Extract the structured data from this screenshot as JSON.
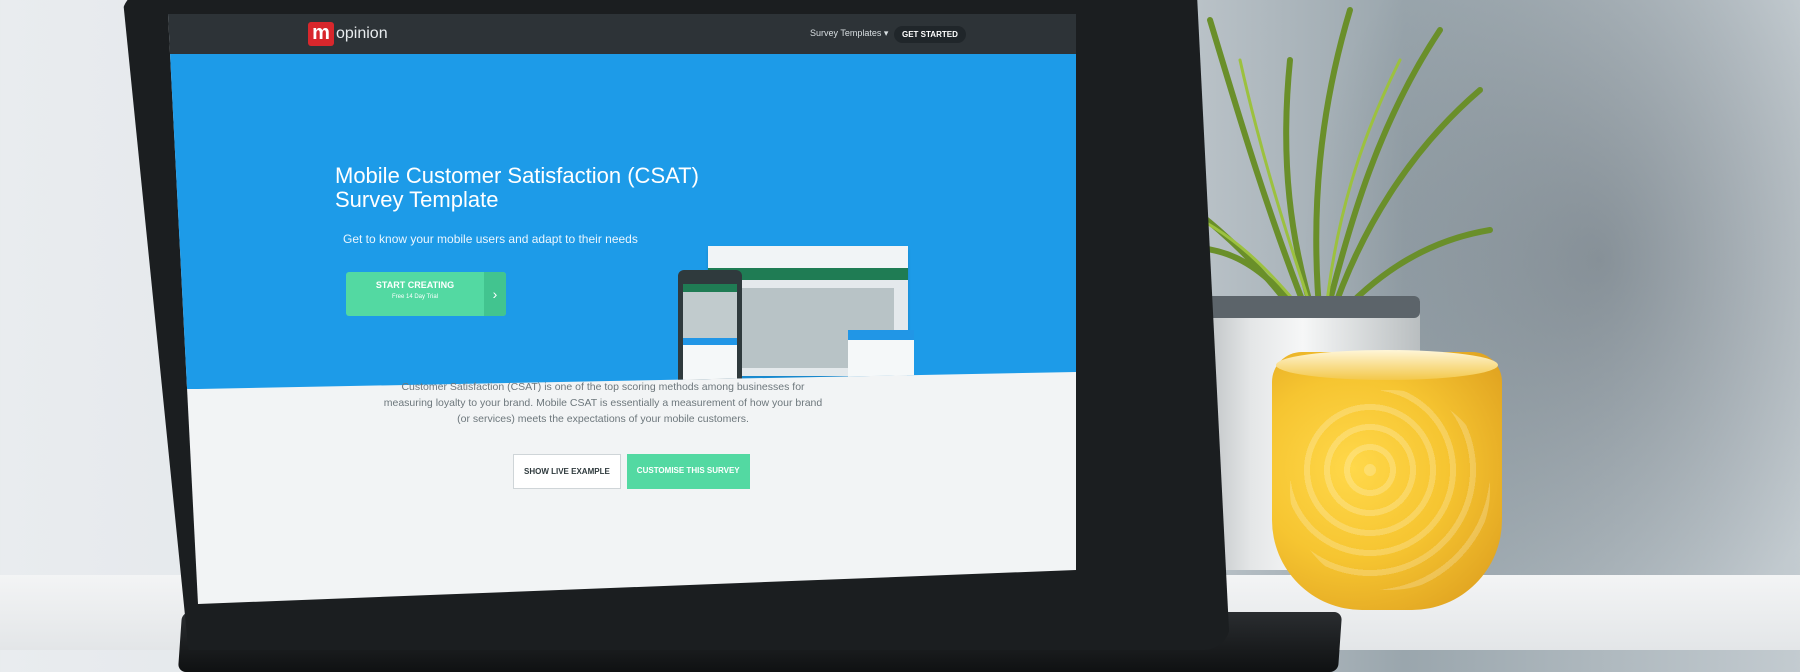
{
  "navbar": {
    "logo_mark": "m",
    "logo_text": "opinion",
    "survey_templates": "Survey Templates",
    "get_started": "GET STARTED"
  },
  "hero": {
    "title": "Mobile Customer Satisfaction (CSAT) Survey Template",
    "subtitle": "Get to know your mobile users and adapt to their needs",
    "cta_main": "START CREATING",
    "cta_sub": "Free 14 Day Trial",
    "cta_arrow": "›"
  },
  "content": {
    "description": "Customer Satisfaction (CSAT) is one of the top scoring methods among businesses for measuring loyalty to your brand. Mobile CSAT is essentially a measurement of how your brand (or services) meets the expectations of your mobile customers.",
    "show_live_example": "SHOW LIVE EXAMPLE",
    "customise_survey": "CUSTOMISE THIS SURVEY"
  },
  "colors": {
    "hero_blue": "#1d9be8",
    "cta_green": "#53d9a2",
    "navbar": "#2d3337",
    "logo_red": "#d8272c"
  }
}
